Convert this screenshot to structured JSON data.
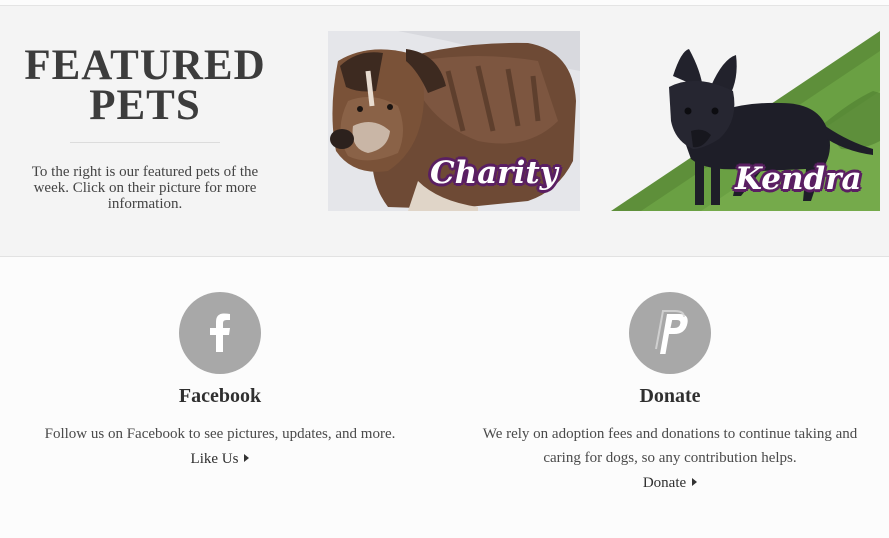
{
  "featured": {
    "title_line1": "FEATURED",
    "title_line2": "PETS",
    "description": "To the right is our featured pets of the week. Click on their picture for more information.",
    "pets": [
      {
        "name": "Charity"
      },
      {
        "name": "Kendra"
      }
    ]
  },
  "facebook": {
    "icon": "facebook-icon",
    "heading": "Facebook",
    "text": "Follow us on Facebook to see pictures, updates, and more.",
    "link_label": "Like Us"
  },
  "donate": {
    "icon": "paypal-icon",
    "heading": "Donate",
    "text": "We rely on adoption fees and donations to continue taking and caring for dogs, so any contribution helps.",
    "link_label": "Donate"
  },
  "colors": {
    "panel_bg": "#f4f4f4",
    "icon_circle": "#a8a8a8",
    "name_outline": "#5a1f62"
  }
}
